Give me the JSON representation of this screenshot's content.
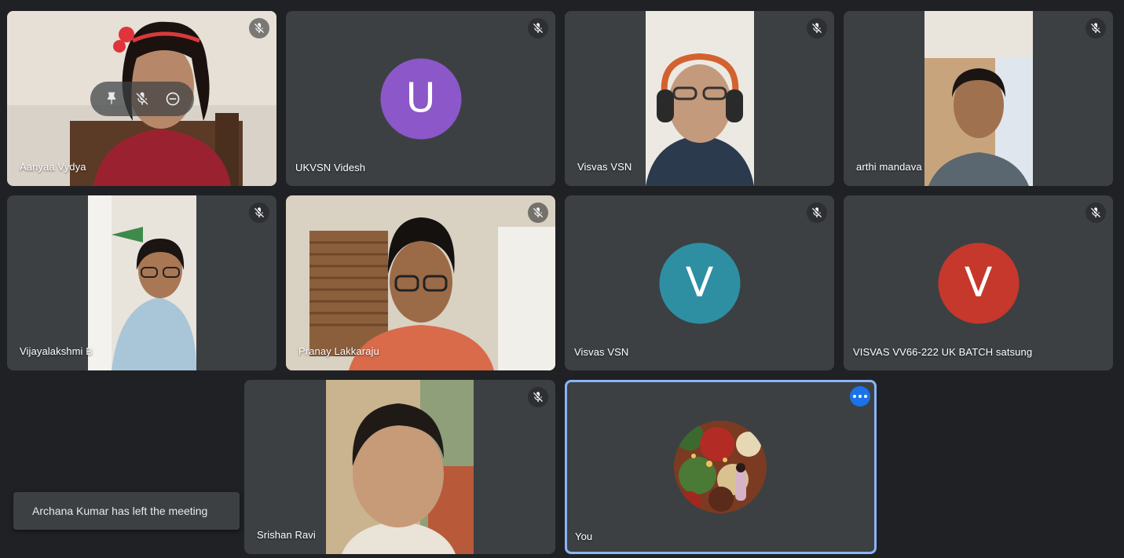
{
  "participants": [
    {
      "name": "Aanyaa Vydya",
      "muted": true,
      "has_video": true
    },
    {
      "name": "UKVSN Videsh",
      "muted": true,
      "has_video": false,
      "avatar_letter": "U",
      "avatar_color": "#8b57c9"
    },
    {
      "name": "Visvas VSN",
      "muted": true,
      "has_video": true
    },
    {
      "name": "arthi mandava",
      "muted": true,
      "has_video": true
    },
    {
      "name": "Vijayalakshmi B",
      "muted": true,
      "has_video": true
    },
    {
      "name": "Pranay Lakkaraju",
      "muted": true,
      "has_video": true
    },
    {
      "name": "Visvas VSN",
      "muted": true,
      "has_video": false,
      "avatar_letter": "V",
      "avatar_color": "#2e8fa3"
    },
    {
      "name": "VISVAS VV66-222 UK BATCH satsung",
      "muted": true,
      "has_video": false,
      "avatar_letter": "V",
      "avatar_color": "#c5382b"
    },
    {
      "name": "Srishan Ravi",
      "muted": true,
      "has_video": true
    },
    {
      "name": "You",
      "muted": false,
      "has_video": false,
      "self": true
    }
  ],
  "tile_hover_controls": [
    "pin-icon",
    "mic-off-icon",
    "remove-icon"
  ],
  "self_tile_menu_icon": "more-horizontal-icon",
  "toast": {
    "text": "Archana Kumar has left the meeting"
  },
  "colors": {
    "background": "#202124",
    "tile": "#3c4043",
    "self_outline": "#8ab4f8",
    "accent": "#1a73e8"
  }
}
